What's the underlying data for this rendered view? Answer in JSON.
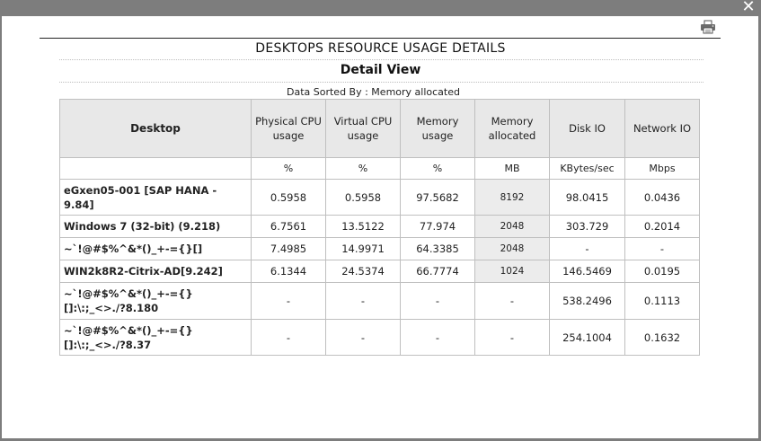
{
  "window": {
    "close_glyph": "✕",
    "print_icon": "printer-icon"
  },
  "header": {
    "title": "DESKTOPS RESOURCE USAGE DETAILS",
    "subtitle": "Detail View",
    "sorted_by": "Data Sorted By : Memory allocated"
  },
  "table": {
    "columns": [
      "Desktop",
      "Physical CPU usage",
      "Virtual CPU usage",
      "Memory usage",
      "Memory allocated",
      "Disk IO",
      "Network IO"
    ],
    "units": [
      "",
      "%",
      "%",
      "%",
      "MB",
      "KBytes/sec",
      "Mbps"
    ],
    "rows": [
      {
        "desktop": "eGxen05-001 [SAP HANA - 9.84]",
        "pcpu": "0.5958",
        "vcpu": "0.5958",
        "mem_usage": "97.5682",
        "mem_alloc": "8192",
        "disk": "98.0415",
        "net": "0.0436"
      },
      {
        "desktop": "Windows 7 (32-bit) (9.218)",
        "pcpu": "6.7561",
        "vcpu": "13.5122",
        "mem_usage": "77.974",
        "mem_alloc": "2048",
        "disk": "303.729",
        "net": "0.2014"
      },
      {
        "desktop": "~`!@#$%^&*()_+-={}[]",
        "pcpu": "7.4985",
        "vcpu": "14.9971",
        "mem_usage": "64.3385",
        "mem_alloc": "2048",
        "disk": "-",
        "net": "-"
      },
      {
        "desktop": "WIN2k8R2-Citrix-AD[9.242]",
        "pcpu": "6.1344",
        "vcpu": "24.5374",
        "mem_usage": "66.7774",
        "mem_alloc": "1024",
        "disk": "146.5469",
        "net": "0.0195"
      },
      {
        "desktop": "~`!@#$%^&*()_+-={}[]:\\:;_<>./?8.180",
        "pcpu": "-",
        "vcpu": "-",
        "mem_usage": "-",
        "mem_alloc": "-",
        "disk": "538.2496",
        "net": "0.1113"
      },
      {
        "desktop": "~`!@#$%^&*()_+-={}[]:\\:;_<>./?8.37",
        "pcpu": "-",
        "vcpu": "-",
        "mem_usage": "-",
        "mem_alloc": "-",
        "disk": "254.1004",
        "net": "0.1632"
      }
    ]
  }
}
